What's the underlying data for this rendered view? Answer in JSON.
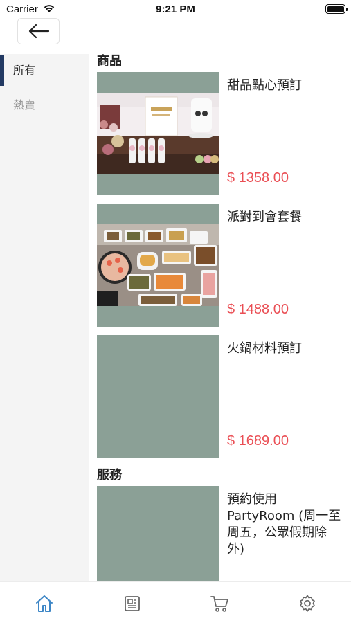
{
  "status_bar": {
    "carrier": "Carrier",
    "time": "9:21 PM"
  },
  "nav": {
    "back_icon": "arrow-left-icon"
  },
  "sidebar": {
    "items": [
      {
        "label": "所有",
        "active": true
      },
      {
        "label": "熱賣",
        "active": false
      }
    ]
  },
  "sections": [
    {
      "title": "商品",
      "products": [
        {
          "name": "甜品點心預訂",
          "price": "$ 1358.00",
          "image": "dessert-table-photo"
        },
        {
          "name": "派對到會套餐",
          "price": "$ 1488.00",
          "image": "party-food-platter-photo"
        },
        {
          "name": "火鍋材料預訂",
          "price": "$ 1689.00",
          "image": "placeholder"
        }
      ]
    },
    {
      "title": "服務",
      "products": [
        {
          "name": "預約使用PartyRoom (周一至周五，公眾假期除外)",
          "image": "placeholder"
        }
      ]
    }
  ],
  "tabbar": {
    "items": [
      {
        "icon": "home-icon",
        "active": true
      },
      {
        "icon": "news-icon",
        "active": false
      },
      {
        "icon": "cart-icon",
        "active": false
      },
      {
        "icon": "gear-icon",
        "active": false
      }
    ]
  },
  "colors": {
    "accent": "#233a63",
    "price": "#ea4e54",
    "placeholder": "#8ba096",
    "tab_active": "#3d86c6"
  }
}
